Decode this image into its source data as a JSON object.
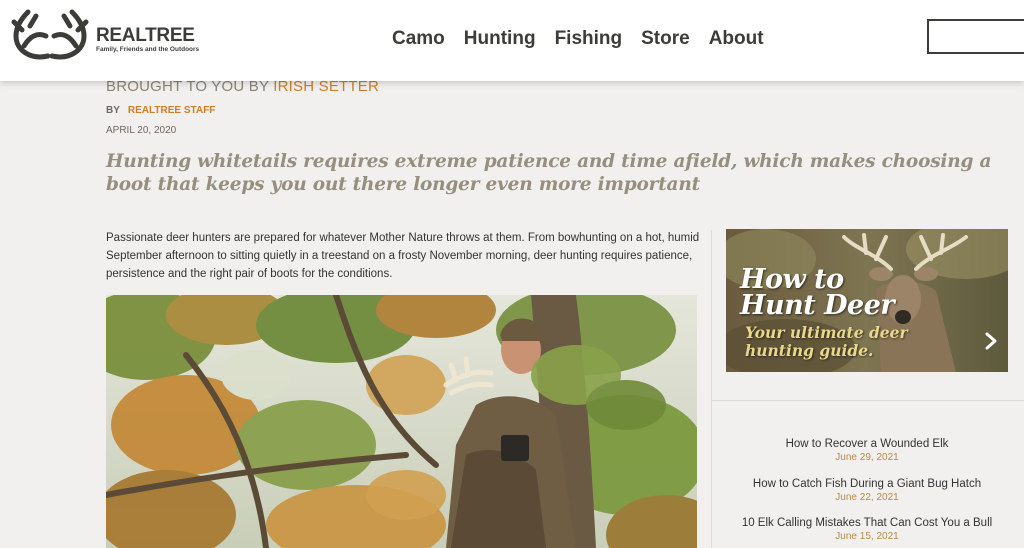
{
  "header": {
    "brand_name": "REALTREE",
    "brand_tagline": "Family, Friends and the Outdoors",
    "logo_icon": "antler-logo-icon",
    "nav": [
      "Camo",
      "Hunting",
      "Fishing",
      "Store",
      "About"
    ],
    "search_placeholder": ""
  },
  "article": {
    "brought_prefix": "BROUGHT TO YOU BY ",
    "sponsor": "IRISH SETTER",
    "by_label": "BY",
    "author": "REALTREE STAFF",
    "date": "APRIL 20, 2020",
    "deck": "Hunting whitetails requires extreme patience and time afield, which makes choosing a boot that keeps you out there longer even more important",
    "paragraph": "Passionate deer hunters are prepared for whatever Mother Nature throws at them. From bowhunting on a hot, humid September afternoon to sitting quietly in a treestand on a frosty November morning, deer hunting requires patience, persistence and the right pair of boots for the conditions.",
    "hero_image": "hunter-in-treestand-with-antlers-photo"
  },
  "sidebar": {
    "promo": {
      "title_line1": "How to",
      "title_line2": "Hunt Deer",
      "subtitle_line1": "Your ultimate deer",
      "subtitle_line2": "hunting guide.",
      "arrow_icon": "chevron-right-icon"
    },
    "stories": [
      {
        "title": "How to Recover a Wounded Elk",
        "date": "June 29, 2021"
      },
      {
        "title": "How to Catch Fish During a Giant Bug Hatch",
        "date": "June 22, 2021"
      },
      {
        "title": "10 Elk Calling Mistakes That Can Cost You a Bull",
        "date": "June 15, 2021"
      }
    ]
  },
  "colors": {
    "accent_orange": "#d07d24",
    "deck_gray": "#968e7e",
    "date_gold": "#b58a46",
    "page_bg": "#f1f0ee"
  }
}
